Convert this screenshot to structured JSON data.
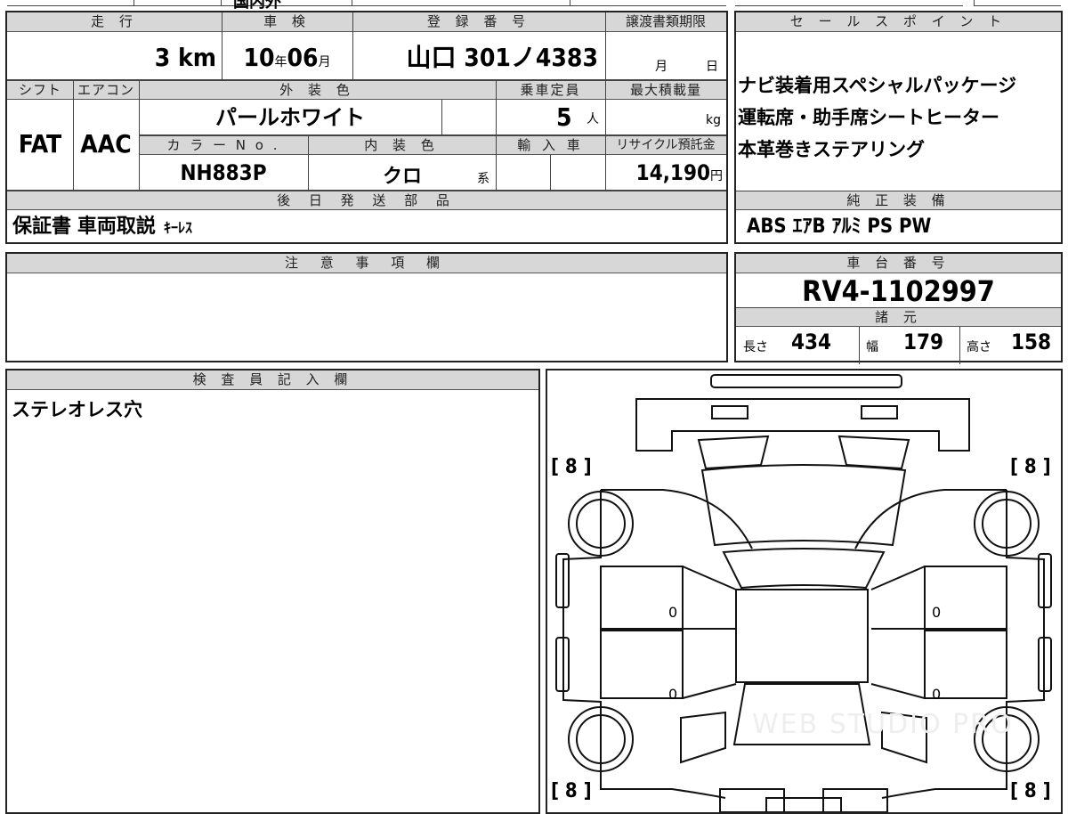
{
  "top_strip": {
    "left_partial": "国内外"
  },
  "main": {
    "headers": {
      "mileage": "走 行",
      "inspection": "車 検",
      "registration": "登 録 番 号",
      "transfer_deadline": "譲渡書類期限",
      "shift": "シフト",
      "aircon": "エアコン",
      "exterior_color": "外 装 色",
      "capacity": "乗車定員",
      "max_load": "最大積載量",
      "color_no": "カ ラ ー N o .",
      "interior_color": "内 装 色",
      "import": "輸 入 車",
      "recycle": "リサイクル預託金",
      "later_parts": "後 日 発 送 部 品"
    },
    "mileage": {
      "value": "3",
      "unit": "km"
    },
    "inspection": {
      "year": "10",
      "year_unit": "年",
      "month": "06",
      "month_unit": "月"
    },
    "registration": {
      "value": "山口 301ノ4383"
    },
    "transfer_deadline": {
      "month_unit": "月",
      "day_unit": "日"
    },
    "shift": {
      "value": "FAT"
    },
    "aircon": {
      "value": "AAC"
    },
    "exterior_color": {
      "value": "パールホワイト"
    },
    "capacity": {
      "value": "5",
      "unit": "人"
    },
    "max_load": {
      "unit": "kg"
    },
    "color_no": {
      "value": "NH883P"
    },
    "interior_color": {
      "value": "クロ",
      "suffix": "系"
    },
    "recycle": {
      "value": "14,190",
      "unit": "円"
    },
    "later_parts": {
      "value": "保証書 車両取説",
      "small": "ｷｰﾚｽ"
    }
  },
  "sales_points": {
    "header": "セ ー ル ス ポ イ ン ト",
    "items": [
      "ナビ装着用スペシャルパッケージ",
      "運転席・助手席シートヒーター",
      "本革巻きステアリング"
    ]
  },
  "genuine_equipment": {
    "header": "純 正 装 備",
    "value": "ABS ｴｱB ｱﾙﾐ PS PW"
  },
  "notes": {
    "header": "注 意 事 項 欄"
  },
  "chassis": {
    "header": "車 台 番 号",
    "value": "RV4-1102997"
  },
  "specs": {
    "header": "諸 元",
    "length_label": "長さ",
    "length": "434",
    "width_label": "幅",
    "width": "179",
    "height_label": "高さ",
    "height": "158"
  },
  "inspector": {
    "header": "検 査 員 記 入 欄",
    "value": "ステレオレス穴"
  },
  "diagram": {
    "tire_labels": [
      "[ 8 ]",
      "[ 8 ]",
      "[ 8 ]",
      "[ 8 ]"
    ],
    "door_marks": [
      "0",
      "0",
      "0",
      "0"
    ],
    "watermark": "WEB STUDIO PRO"
  }
}
